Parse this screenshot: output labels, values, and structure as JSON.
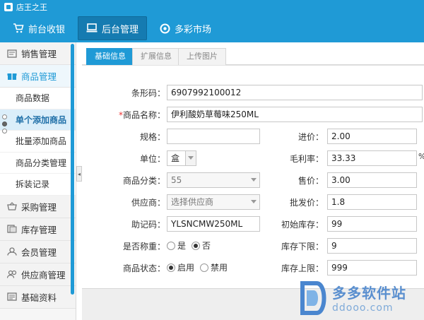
{
  "window": {
    "title": "店王之王"
  },
  "topnav": {
    "items": [
      {
        "label": "前台收银",
        "icon": "cart-icon"
      },
      {
        "label": "后台管理",
        "icon": "monitor-icon",
        "active": true
      },
      {
        "label": "多彩市场",
        "icon": "gear-icon"
      }
    ]
  },
  "sidebar": {
    "sections": {
      "sales": "销售管理",
      "goods": "商品管理",
      "purchase": "采购管理",
      "stock": "库存管理",
      "member": "会员管理",
      "supplier": "供应商管理",
      "basic": "基础资料"
    },
    "goods_sub": [
      "商品数据",
      "单个添加商品",
      "批量添加商品",
      "商品分类管理",
      "拆装记录"
    ]
  },
  "tabs": [
    "基础信息",
    "扩展信息",
    "上传图片"
  ],
  "form": {
    "barcode": {
      "label": "条形码：",
      "value": "6907992100012"
    },
    "name": {
      "required": "*",
      "label": "商品名称：",
      "value": "伊利酸奶草莓味250ML"
    },
    "spec": {
      "label": "规格：",
      "value": ""
    },
    "cost": {
      "label": "进价：",
      "value": "2.00"
    },
    "unit": {
      "label": "单位：",
      "value": "盒"
    },
    "margin": {
      "label": "毛利率：",
      "value": "33.33",
      "suffix": "%"
    },
    "category": {
      "label": "商品分类：",
      "value": "55"
    },
    "price": {
      "label": "售价：",
      "value": "3.00"
    },
    "supplier": {
      "label": "供应商：",
      "value": "选择供应商"
    },
    "wholesale": {
      "label": "批发价：",
      "value": "1.8"
    },
    "mnemonic": {
      "label": "助记码：",
      "value": "YLSNCMW250ML"
    },
    "init_stock": {
      "label": "初始库存：",
      "value": "99"
    },
    "weighed": {
      "label": "是否称重：",
      "opt_yes": "是",
      "opt_no": "否"
    },
    "stock_min": {
      "label": "库存下限：",
      "value": "9"
    },
    "status": {
      "label": "商品状态：",
      "opt_on": "启用",
      "opt_off": "禁用"
    },
    "stock_max": {
      "label": "库存上限：",
      "value": "999"
    }
  },
  "watermark": {
    "name": "多多软件站",
    "url": "ddooo.com"
  },
  "colors": {
    "primary": "#1f9ad6",
    "active_nav": "#157bb1",
    "sidebar_active": "#dbeefa"
  }
}
